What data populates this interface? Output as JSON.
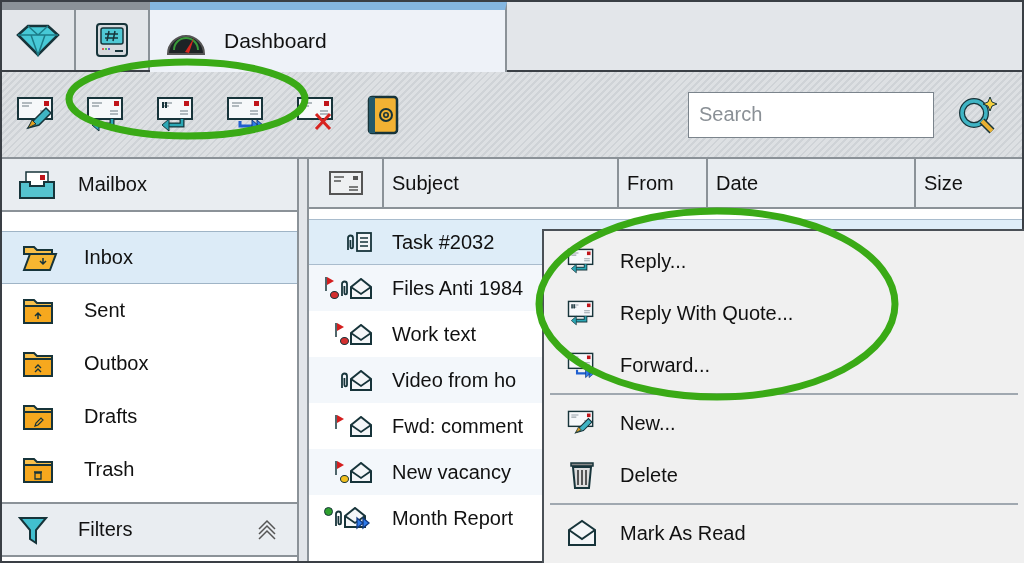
{
  "tabs": [
    {
      "kind": "gem",
      "selected": false
    },
    {
      "kind": "terminal",
      "selected": false
    },
    {
      "kind": "gauge",
      "label": "Dashboard",
      "selected": true
    }
  ],
  "toolbar": {
    "buttons": [
      {
        "kind": "new"
      },
      {
        "kind": "reply"
      },
      {
        "kind": "reply-quote"
      },
      {
        "kind": "forward"
      },
      {
        "kind": "delete"
      },
      {
        "kind": "address-book"
      }
    ],
    "search": {
      "placeholder": "Search"
    }
  },
  "sidebar": {
    "title": "Mailbox",
    "folders": [
      {
        "kind": "inbox",
        "label": "Inbox",
        "selected": true
      },
      {
        "kind": "sent",
        "label": "Sent",
        "selected": false
      },
      {
        "kind": "outbox",
        "label": "Outbox",
        "selected": false
      },
      {
        "kind": "drafts",
        "label": "Drafts",
        "selected": false
      },
      {
        "kind": "trash",
        "label": "Trash",
        "selected": false
      }
    ],
    "footer": "Filters"
  },
  "table": {
    "columns": [
      "Subject",
      "From",
      "Date",
      "Size"
    ],
    "rows": [
      {
        "subject": "Task #2032",
        "flagged": false,
        "attachment": true,
        "kind": "note",
        "selected": true
      },
      {
        "subject": "Files Anti 1984",
        "flagged": true,
        "color": "#d32f2f",
        "attachment": true,
        "kind": "open",
        "selected": false
      },
      {
        "subject": "Work text",
        "flagged": true,
        "color": "#d32f2f",
        "attachment": false,
        "kind": "open",
        "selected": false
      },
      {
        "subject": "Video from ho",
        "flagged": false,
        "attachment": true,
        "kind": "open",
        "selected": false
      },
      {
        "subject": "Fwd: comment",
        "flagged": true,
        "attachment": false,
        "kind": "open",
        "selected": false
      },
      {
        "subject": "New vacancy",
        "flagged": true,
        "color": "#f2c01e",
        "attachment": false,
        "kind": "open",
        "selected": false
      },
      {
        "subject": "Month Report",
        "flagged": false,
        "color": "#2ea02e",
        "attachment": true,
        "kind": "forwarded",
        "selected": false
      }
    ]
  },
  "context_menu": {
    "groups": [
      [
        {
          "kind": "reply",
          "label": "Reply..."
        },
        {
          "kind": "reply-quote",
          "label": "Reply With Quote..."
        },
        {
          "kind": "forward",
          "label": "Forward..."
        }
      ],
      [
        {
          "kind": "new",
          "label": "New..."
        },
        {
          "kind": "delete",
          "label": "Delete"
        }
      ],
      [
        {
          "kind": "mark-read",
          "label": "Mark As Read"
        }
      ]
    ]
  }
}
